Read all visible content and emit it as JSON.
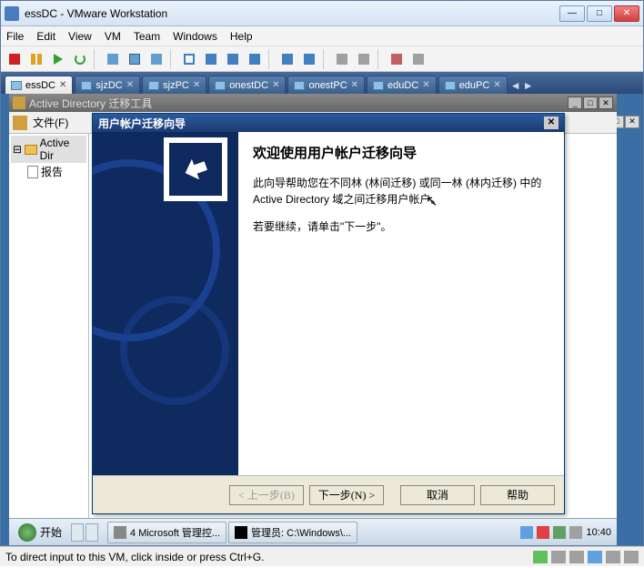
{
  "window": {
    "title": "essDC - VMware Workstation",
    "controls": {
      "min": "—",
      "max": "□",
      "close": "✕"
    }
  },
  "menu": {
    "file": "File",
    "edit": "Edit",
    "view": "View",
    "vm": "VM",
    "team": "Team",
    "windows": "Windows",
    "help": "Help"
  },
  "tabs": [
    {
      "label": "essDC",
      "active": true
    },
    {
      "label": "sjzDC",
      "active": false
    },
    {
      "label": "sjzPC",
      "active": false
    },
    {
      "label": "onestDC",
      "active": false
    },
    {
      "label": "onestPC",
      "active": false
    },
    {
      "label": "eduDC",
      "active": false
    },
    {
      "label": "eduPC",
      "active": false
    }
  ],
  "ad_window": {
    "title": "Active Directory 迁移工具",
    "file_menu": "文件(F)",
    "tree": {
      "root": "Active Dir",
      "child": "报告"
    }
  },
  "wizard": {
    "title": "用户帐户迁移向导",
    "heading": "欢迎使用用户帐户迁移向导",
    "p1": "此向导帮助您在不同林 (林间迁移) 或同一林 (林内迁移) 中的 Active Directory 域之间迁移用户帐户。",
    "p2": "若要继续，请单击\"下一步\"。",
    "back": "< 上一步(B)",
    "next": "下一步(N) >",
    "cancel": "取消",
    "help": "帮助"
  },
  "taskbar": {
    "start": "开始",
    "tasks": [
      {
        "label": "4 Microsoft 管理控..."
      },
      {
        "label": "管理员: C:\\Windows\\..."
      }
    ],
    "time": "10:40"
  },
  "statusbar": {
    "text": "To direct input to this VM, click inside or press Ctrl+G."
  },
  "colors": {
    "accent": "#1a3a70",
    "wizard_side": "#0e2a5e"
  }
}
